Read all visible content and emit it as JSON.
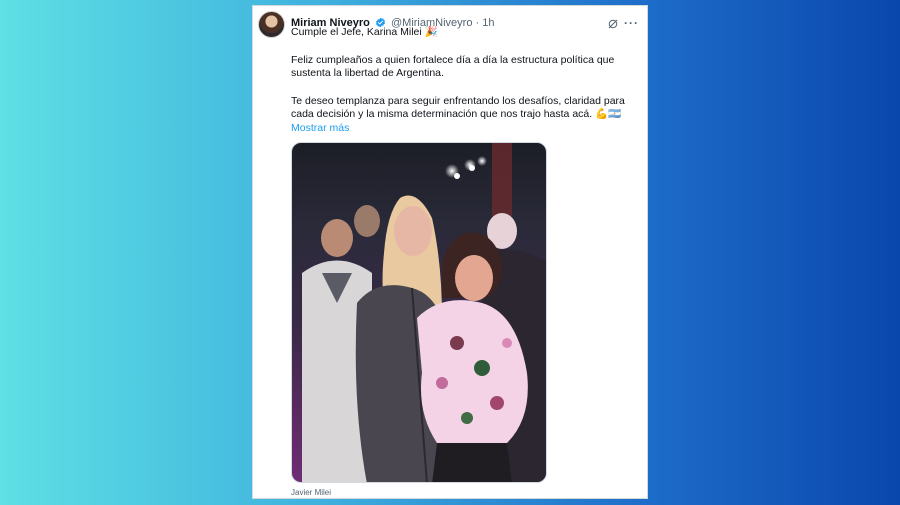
{
  "tweet": {
    "author_name": "Miriam Niveyro",
    "handle": "@MiriamNiveyro",
    "separator": "·",
    "time": "1h",
    "line1": "Cumple el Jefe, Karina Milei 🎉",
    "paragraph2": "Feliz cumpleaños a quien fortalece día a día la estructura política que sustenta la libertad de Argentina.",
    "paragraph3": "Te deseo templanza para seguir enfrentando los desafíos, claridad para cada decisión y la misma determinación que nos trajo hasta acá. 💪🇦🇷",
    "show_more": "Mostrar más",
    "media_caption": "Javier Milei"
  },
  "icons": {
    "verified": "verified-badge-icon",
    "grok": "grok-icon",
    "more": "more-options-icon"
  },
  "colors": {
    "accent": "#1d9bf0",
    "text": "#0f1419",
    "muted": "#536471"
  }
}
